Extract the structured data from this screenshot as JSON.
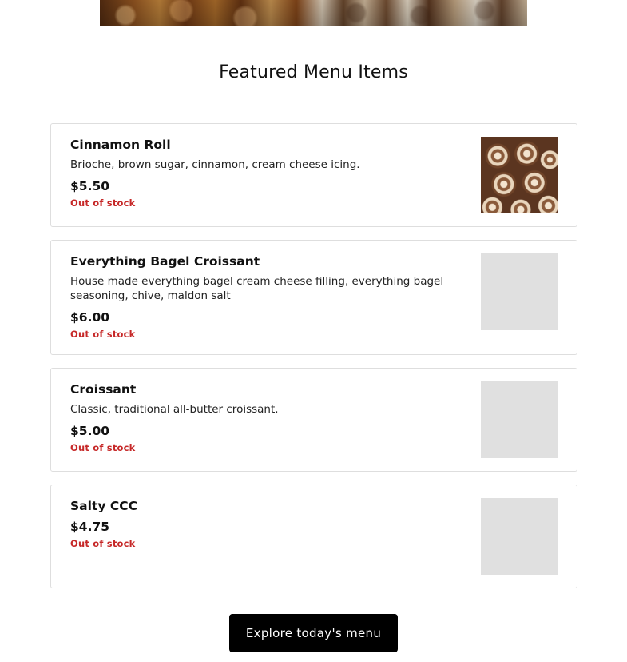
{
  "hero": {
    "image": "pastries-banner-image"
  },
  "featured": {
    "title": "Featured Menu Items",
    "items": [
      {
        "name": "Cinnamon Roll",
        "description": "Brioche, brown sugar, cinnamon, cream cheese icing.",
        "price": "$5.50",
        "status": "Out of stock",
        "image": "cinnamon-roll-photo"
      },
      {
        "name": "Everything Bagel Croissant",
        "description": "House made everything bagel cream cheese filling, everything bagel seasoning, chive, maldon salt",
        "price": "$6.00",
        "status": "Out of stock",
        "image": "placeholder"
      },
      {
        "name": "Croissant",
        "description": "Classic, traditional all-butter croissant.",
        "price": "$5.00",
        "status": "Out of stock",
        "image": "placeholder"
      },
      {
        "name": "Salty CCC",
        "description": "",
        "price": "$4.75",
        "status": "Out of stock",
        "image": "placeholder"
      }
    ]
  },
  "cta": {
    "label": "Explore today's menu"
  },
  "colors": {
    "status_out_of_stock": "#c62828",
    "button_bg": "#000000",
    "button_text": "#ffffff",
    "placeholder": "#e0e0e0",
    "card_border": "#dedede"
  }
}
